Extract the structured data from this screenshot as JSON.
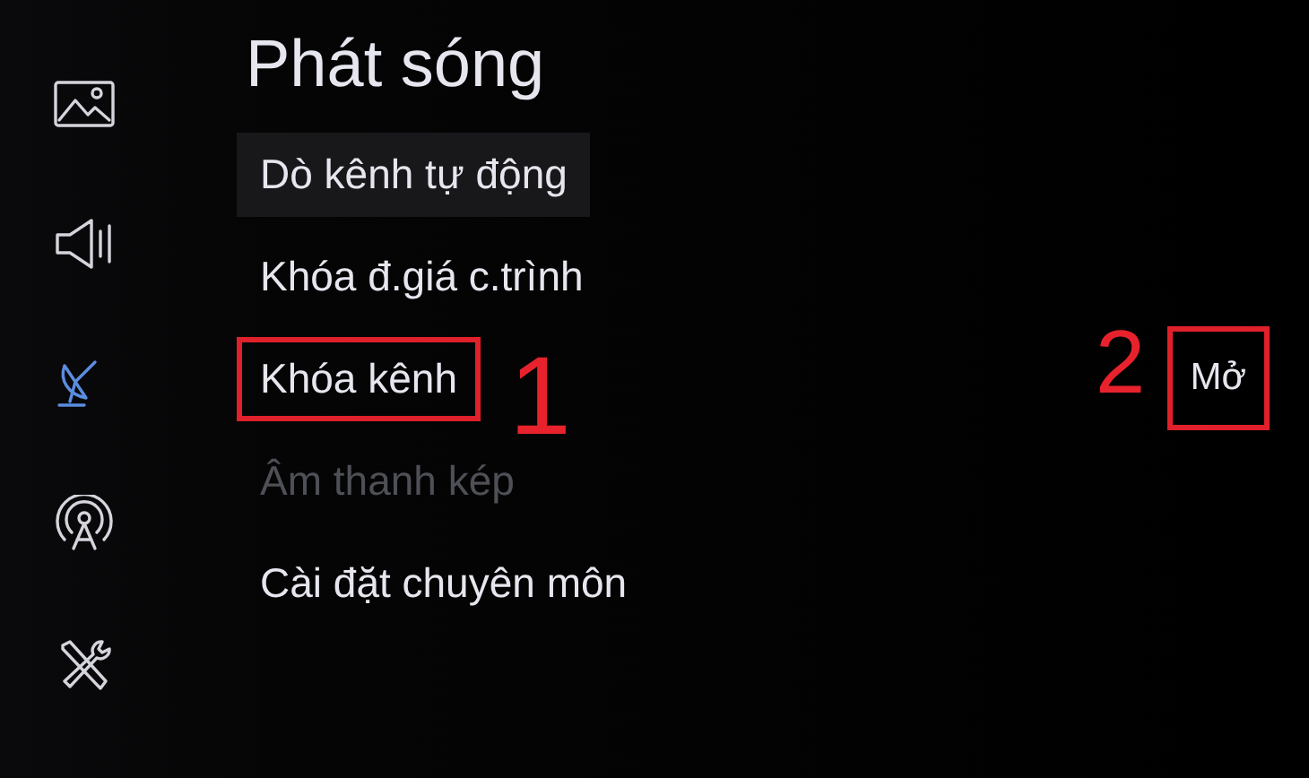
{
  "sidebar": {
    "items": [
      {
        "kind": "picture",
        "selected": false
      },
      {
        "kind": "sound",
        "selected": false
      },
      {
        "kind": "broadcast",
        "selected": true
      },
      {
        "kind": "network",
        "selected": false
      },
      {
        "kind": "support",
        "selected": false
      }
    ]
  },
  "menu": {
    "title": "Phát sóng",
    "items": [
      {
        "label": "Dò kênh tự động",
        "selected": true,
        "disabled": false,
        "annotated": false
      },
      {
        "label": "Khóa đ.giá c.trình",
        "selected": false,
        "disabled": false,
        "annotated": false
      },
      {
        "label": "Khóa kênh",
        "selected": false,
        "disabled": false,
        "annotated": true,
        "callout": "1",
        "value": {
          "text": "Mở",
          "annotated": true,
          "callout": "2"
        }
      },
      {
        "label": "Âm thanh kép",
        "selected": false,
        "disabled": true,
        "annotated": false
      },
      {
        "label": "Cài đặt chuyên môn",
        "selected": false,
        "disabled": false,
        "annotated": false
      }
    ]
  }
}
